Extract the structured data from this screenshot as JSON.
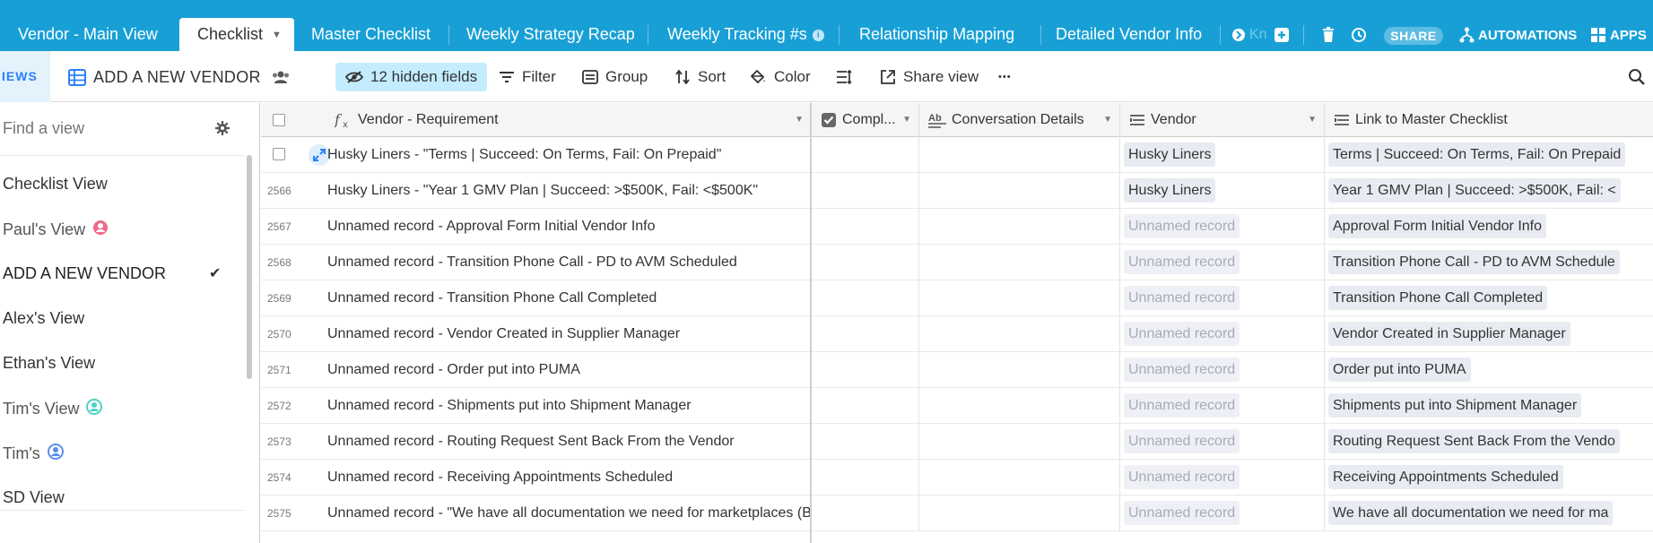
{
  "tabs": [
    {
      "label": "Vendor - Main View"
    },
    {
      "label": "Checklist"
    },
    {
      "label": "Master Checklist"
    },
    {
      "label": "Weekly Strategy Recap"
    },
    {
      "label": "Weekly Tracking #s"
    },
    {
      "label": "Relationship Mapping"
    },
    {
      "label": "Detailed Vendor Info"
    }
  ],
  "tabbar": {
    "ghost_tab": "Kn",
    "share_label": "SHARE",
    "automations_label": "AUTOMATIONS",
    "apps_label": "APPS",
    "info_glyph": "i"
  },
  "viewbar": {
    "views_label": "IEWS",
    "current_view": "ADD A NEW VENDOR",
    "hidden_fields": "12 hidden fields",
    "filter": "Filter",
    "group": "Group",
    "sort": "Sort",
    "color": "Color",
    "share_view": "Share view",
    "more": "•••"
  },
  "sidebar": {
    "find_placeholder": "Find a view",
    "items": [
      {
        "label": "Checklist View",
        "style": "bold"
      },
      {
        "label": "Paul's View",
        "style": "dim",
        "icon_color": "#f06a8a"
      },
      {
        "label": "ADD A NEW VENDOR",
        "style": "active"
      },
      {
        "label": "Alex's View",
        "style": "bold"
      },
      {
        "label": "Ethan's View",
        "style": "bold"
      },
      {
        "label": "Tim's View",
        "style": "dim",
        "icon_color": "#4fd1c5"
      },
      {
        "label": "Tim's",
        "style": "dim",
        "icon_color": "#5b8def"
      },
      {
        "label": "SD View",
        "style": "bold"
      }
    ],
    "active_check": "✔"
  },
  "columns": [
    {
      "label": "Vendor - Requirement"
    },
    {
      "label": "Compl..."
    },
    {
      "label": "Conversation Details"
    },
    {
      "label": "Vendor"
    },
    {
      "label": "Link to Master Checklist"
    }
  ],
  "rows": [
    {
      "num": "",
      "requirement": "Husky Liners - \"Terms | Succeed: On Terms, Fail: On Prepaid\"",
      "vendor": "Husky Liners",
      "vendor_muted": false,
      "link": "Terms | Succeed: On Terms, Fail: On Prepaid"
    },
    {
      "num": "2566",
      "requirement": "Husky Liners - \"Year 1 GMV Plan | Succeed: >$500K, Fail: <$500K\"",
      "vendor": "Husky Liners",
      "vendor_muted": false,
      "link": "Year 1 GMV Plan | Succeed: >$500K, Fail: <"
    },
    {
      "num": "2567",
      "requirement": "Unnamed record - Approval Form Initial Vendor Info",
      "vendor": "Unnamed record",
      "vendor_muted": true,
      "link": "Approval Form Initial Vendor Info"
    },
    {
      "num": "2568",
      "requirement": "Unnamed record - Transition Phone Call - PD to AVM Scheduled",
      "vendor": "Unnamed record",
      "vendor_muted": true,
      "link": "Transition Phone Call - PD to AVM Schedule"
    },
    {
      "num": "2569",
      "requirement": "Unnamed record - Transition Phone Call Completed",
      "vendor": "Unnamed record",
      "vendor_muted": true,
      "link": "Transition Phone Call Completed"
    },
    {
      "num": "2570",
      "requirement": "Unnamed record - Vendor Created in Supplier Manager",
      "vendor": "Unnamed record",
      "vendor_muted": true,
      "link": "Vendor Created in Supplier Manager"
    },
    {
      "num": "2571",
      "requirement": "Unnamed record - Order put into PUMA",
      "vendor": "Unnamed record",
      "vendor_muted": true,
      "link": "Order put into PUMA"
    },
    {
      "num": "2572",
      "requirement": "Unnamed record - Shipments put into Shipment Manager",
      "vendor": "Unnamed record",
      "vendor_muted": true,
      "link": "Shipments put into Shipment Manager"
    },
    {
      "num": "2573",
      "requirement": "Unnamed record - Routing Request Sent Back From the Vendor",
      "vendor": "Unnamed record",
      "vendor_muted": true,
      "link": "Routing Request Sent Back From the Vendo"
    },
    {
      "num": "2574",
      "requirement": "Unnamed record - Receiving Appointments Scheduled",
      "vendor": "Unnamed record",
      "vendor_muted": true,
      "link": "Receiving Appointments Scheduled"
    },
    {
      "num": "2575",
      "requirement": "Unnamed record - \"We have all documentation we need for marketplaces (Ba...",
      "vendor": "Unnamed record",
      "vendor_muted": true,
      "link": "We have all documentation we need for ma"
    }
  ],
  "colors": {
    "tabbar_bg": "#18a0d6",
    "hidden_fields_bg": "#c4ecff",
    "accent_blue": "#2d7ff9"
  }
}
